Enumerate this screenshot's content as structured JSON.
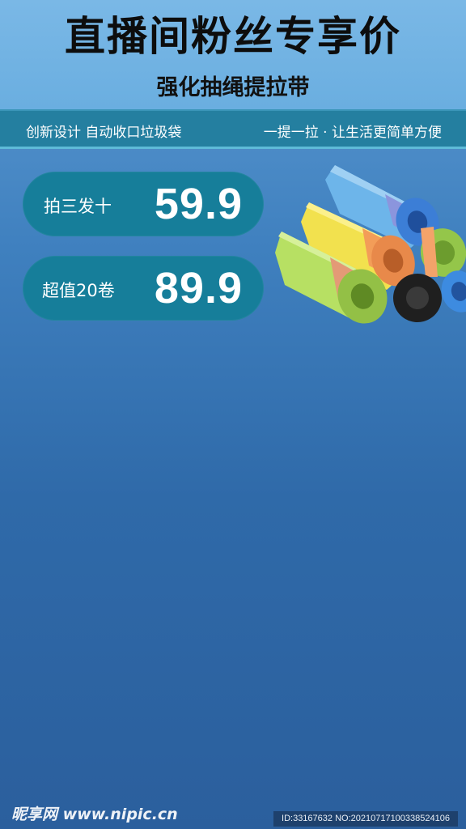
{
  "header": {
    "title": "直播间粉丝专享价",
    "subtitle": "强化抽绳提拉带"
  },
  "strip": {
    "left_text": "创新设计  自动收口垃圾袋",
    "right_text": "一提一拉 · 让生活更简单方便"
  },
  "offers": [
    {
      "label": "拍三发十",
      "price": "59.9"
    },
    {
      "label": "超值20卷",
      "price": "89.9"
    }
  ],
  "product_image": {
    "icon": "trash-bag-rolls-icon",
    "roll_colors": [
      "#5fa6e0",
      "#f0de4a",
      "#a3d64a",
      "#9ac94e",
      "#1f1f1f",
      "#3d8be0"
    ],
    "band_colors": [
      "#8ba0e0",
      "#f39d58",
      "#e39a76",
      "#f3a36a"
    ]
  },
  "watermark": {
    "brand": "昵享网 www.nipic.cn",
    "id_text": "ID:33167632 NO:20210717100338524106"
  },
  "colors": {
    "header_bg": "#6aaee0",
    "strip_bg": "#247fa0",
    "pill_bg": "#167e9a"
  }
}
